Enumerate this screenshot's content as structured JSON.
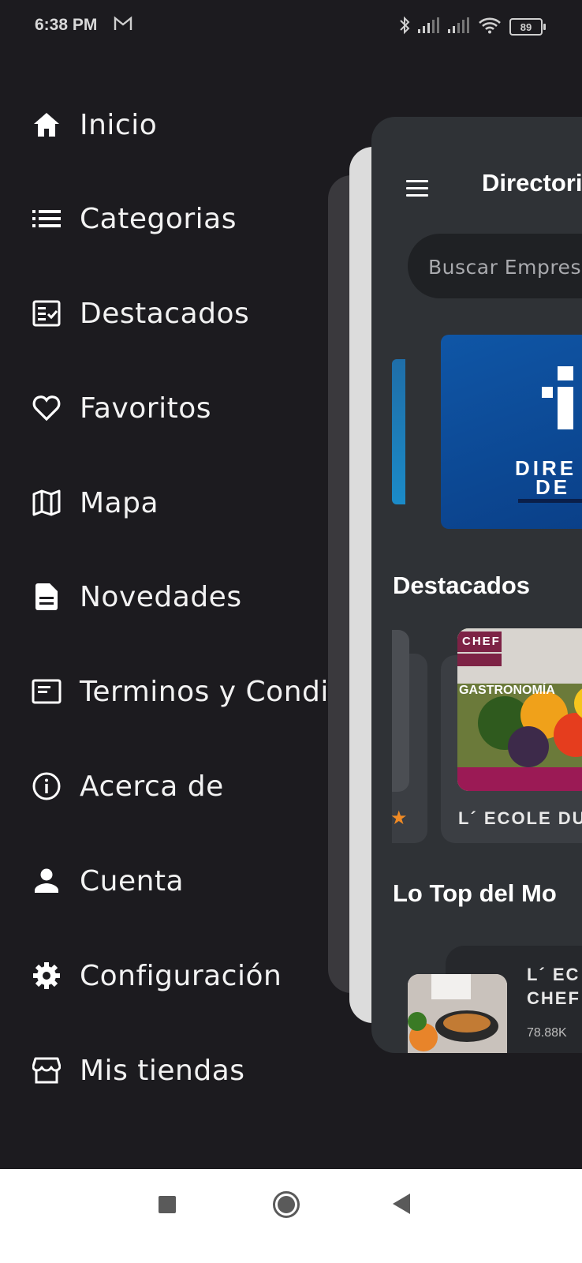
{
  "status_bar": {
    "time": "6:38 PM",
    "battery": "89",
    "icons": [
      "gmail-icon",
      "bluetooth-icon",
      "signal-icon",
      "signal-icon",
      "wifi-icon",
      "battery-icon"
    ]
  },
  "drawer": {
    "items": [
      {
        "label": "Inicio",
        "icon": "home-icon"
      },
      {
        "label": "Categorias",
        "icon": "list-icon"
      },
      {
        "label": "Destacados",
        "icon": "checklist-icon"
      },
      {
        "label": "Favoritos",
        "icon": "heart-icon"
      },
      {
        "label": "Mapa",
        "icon": "map-icon"
      },
      {
        "label": "Novedades",
        "icon": "article-icon"
      },
      {
        "label": "Terminos y Condiciones",
        "icon": "terms-icon"
      },
      {
        "label": "Acerca de",
        "icon": "info-icon"
      },
      {
        "label": "Cuenta",
        "icon": "person-icon"
      },
      {
        "label": "Configuración",
        "icon": "gear-icon"
      },
      {
        "label": "Mis tiendas",
        "icon": "store-icon"
      }
    ]
  },
  "app": {
    "title": "Directorio",
    "search_placeholder": "Buscar Empresas",
    "banner_line1": "DIRE",
    "banner_line2": "DE",
    "section_featured": "Destacados",
    "featured_name": "L´ ECOLE DU",
    "featured_image_text1": "CHEF",
    "featured_image_text2": "GASTRONOMÍA",
    "section_top": "Lo Top del Mo",
    "top_item_line1": "L´ EC",
    "top_item_line2": "CHEF",
    "top_item_views": "78.88K"
  },
  "colors": {
    "background": "#1c1b1f",
    "card": "#2f3236",
    "accent_star": "#f08a24",
    "banner": "#0f56a6"
  }
}
